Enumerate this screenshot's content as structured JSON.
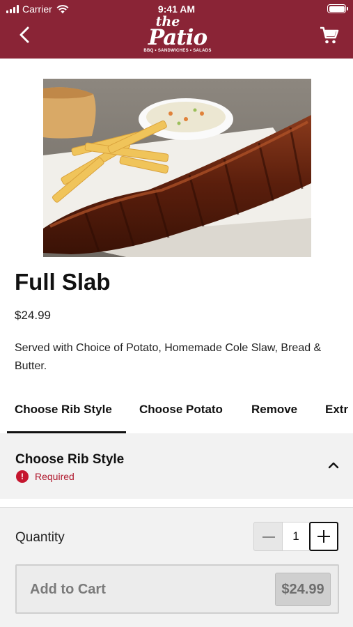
{
  "status_bar": {
    "carrier": "Carrier",
    "time": "9:41 AM"
  },
  "header": {
    "background": "#8a2436",
    "logo": {
      "line1": "the",
      "line2": "Patio",
      "tagline": "BBQ • SANDWICHES • SALADS"
    },
    "icons": {
      "back": "chevron-left-icon",
      "cart": "shopping-cart-icon"
    }
  },
  "product": {
    "image": "ribs-fries-coleslaw-photo",
    "name": "Full Slab",
    "price": "$24.99",
    "description": "Served with Choice of Potato, Homemade Cole Slaw, Bread & Butter."
  },
  "tabs": [
    {
      "label": "Choose Rib Style",
      "active": true
    },
    {
      "label": "Choose Potato",
      "active": false
    },
    {
      "label": "Remove",
      "active": false
    },
    {
      "label": "Extr",
      "active": false
    }
  ],
  "section": {
    "title": "Choose Rib Style",
    "required_label": "Required",
    "required_color": "#b0182d",
    "expanded": true
  },
  "order": {
    "quantity_label": "Quantity",
    "quantity": "1",
    "add_to_cart_label": "Add to Cart",
    "total": "$24.99"
  }
}
